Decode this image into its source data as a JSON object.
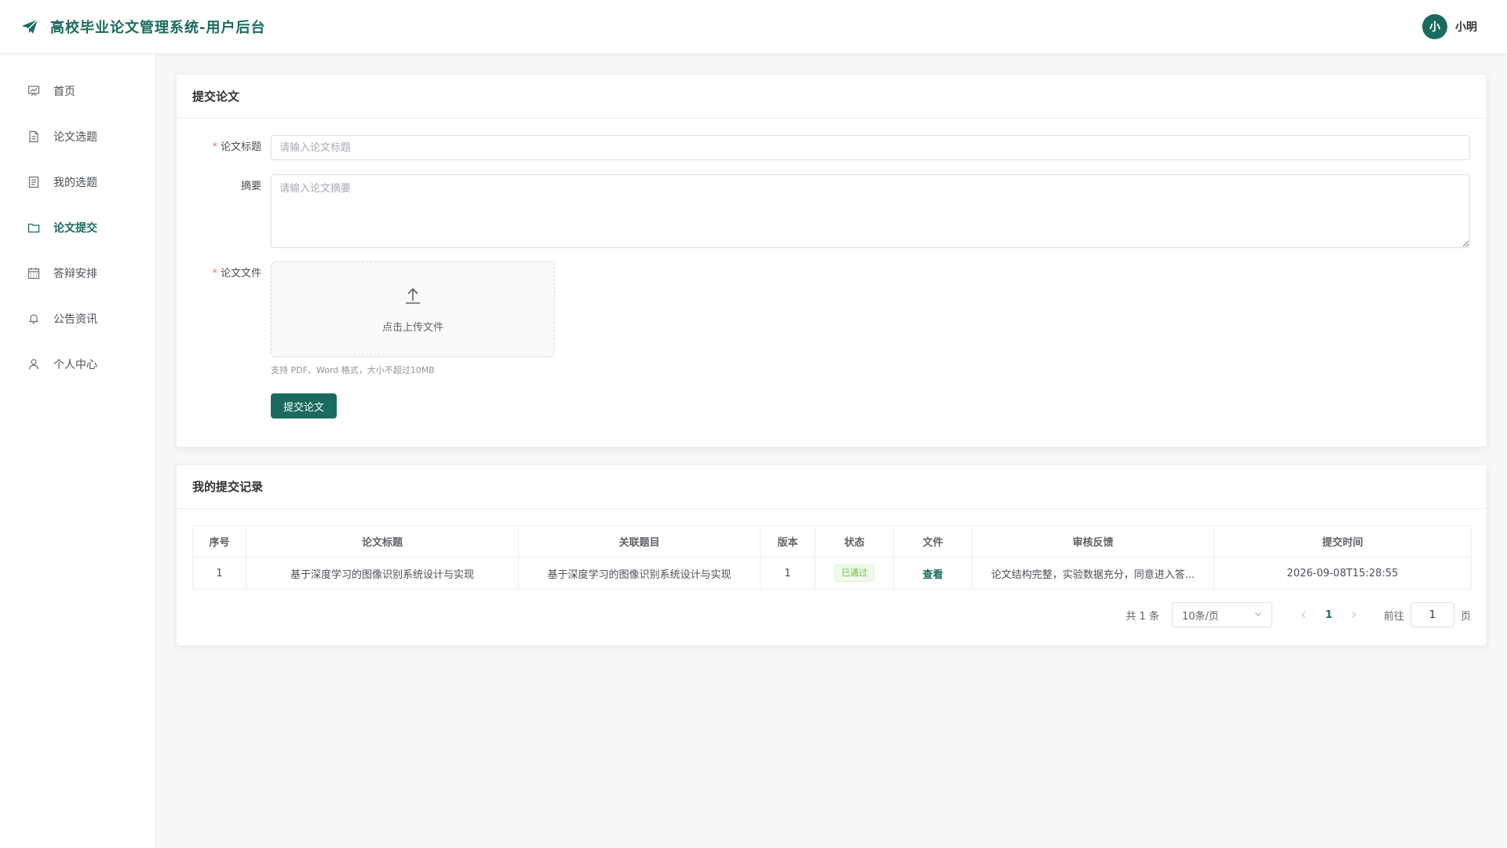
{
  "header": {
    "title": "高校毕业论文管理系统-用户后台",
    "avatar_text": "小",
    "username": "小明"
  },
  "sidebar": {
    "items": [
      {
        "label": "首页",
        "icon": "chart-board-icon",
        "active": false
      },
      {
        "label": "论文选题",
        "icon": "document-icon",
        "active": false
      },
      {
        "label": "我的选题",
        "icon": "list-document-icon",
        "active": false
      },
      {
        "label": "论文提交",
        "icon": "folder-icon",
        "active": true
      },
      {
        "label": "答辩安排",
        "icon": "calendar-icon",
        "active": false
      },
      {
        "label": "公告资讯",
        "icon": "bell-icon",
        "active": false
      },
      {
        "label": "个人中心",
        "icon": "user-icon",
        "active": false
      }
    ]
  },
  "submit_form": {
    "card_title": "提交论文",
    "title_label": "论文标题",
    "title_placeholder": "请输入论文标题",
    "abstract_label": "摘要",
    "abstract_placeholder": "请输入论文摘要",
    "file_label": "论文文件",
    "upload_text": "点击上传文件",
    "upload_tip": "支持 PDF、Word 格式，大小不超过10MB",
    "submit_label": "提交论文"
  },
  "records": {
    "card_title": "我的提交记录",
    "columns": [
      "序号",
      "论文标题",
      "关联题目",
      "版本",
      "状态",
      "文件",
      "审核反馈",
      "提交时间"
    ],
    "rows": [
      {
        "index": "1",
        "title": "基于深度学习的图像识别系统设计与实现",
        "topic": "基于深度学习的图像识别系统设计与实现",
        "version": "1",
        "status": "已通过",
        "file": "查看",
        "feedback": "论文结构完整，实验数据充分，同意进入答...",
        "time": "2026-09-08T15:28:55"
      }
    ]
  },
  "pagination": {
    "total": "共 1 条",
    "page_size": "10条/页",
    "current_page": "1",
    "goto_label": "前往",
    "goto_value": "1",
    "page_suffix": "页"
  },
  "colors": {
    "brand": "#1a6b5e",
    "success": "#67c23a",
    "required": "#f56c6c"
  }
}
